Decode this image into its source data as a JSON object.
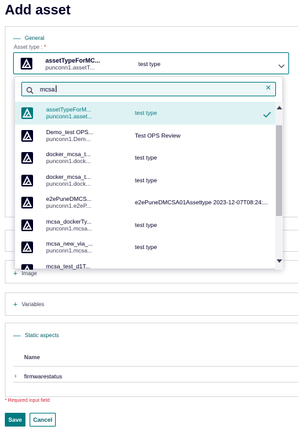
{
  "page": {
    "title": "Add asset"
  },
  "general": {
    "section_title": "General",
    "asset_type_label": "Asset type :",
    "required_marker": "*",
    "selected": {
      "name": "assetTypeForMC...",
      "sub": "punconn1.assetT...",
      "type": "test type"
    }
  },
  "dropdown": {
    "search_value": "mcsa",
    "options": [
      {
        "name": "assetTypeForM...",
        "sub": "punconn1.asset...",
        "type": "test type",
        "selected": true
      },
      {
        "name": "Demo_test OPS...",
        "sub": "punconn1.Dem...",
        "type": "Test OPS Review",
        "selected": false
      },
      {
        "name": "docker_mcsa_t...",
        "sub": "punconn1.dock...",
        "type": "test type",
        "selected": false
      },
      {
        "name": "docker_mcsa_t...",
        "sub": "punconn1.dock...",
        "type": "test type",
        "selected": false
      },
      {
        "name": "e2ePuneDMCS...",
        "sub": "punconn1.e2eP...",
        "type": "e2ePuneDMCSA01Assettype 2023-12-07T08:24:...",
        "selected": false
      },
      {
        "name": "mcsa_dockerTy...",
        "sub": "punconn1.mcsa...",
        "type": "test type",
        "selected": false
      },
      {
        "name": "mcsa_new_via_...",
        "sub": "punconn1.mcsa...",
        "type": "test type",
        "selected": false
      },
      {
        "name": "mcsa_test_d1T...",
        "sub": "",
        "type": "",
        "selected": false
      }
    ]
  },
  "sections": {
    "image": "Image",
    "variables": "Variables",
    "static_aspects": "Static aspects"
  },
  "static_table": {
    "column_name": "Name",
    "rows": [
      "firmwarestatus"
    ]
  },
  "footer": {
    "required_note": "* Required input field",
    "save_label": "Save",
    "cancel_label": "Cancel"
  },
  "colors": {
    "accent": "#007a82",
    "required": "#d72339",
    "selected_bg": "#dff2f3"
  }
}
